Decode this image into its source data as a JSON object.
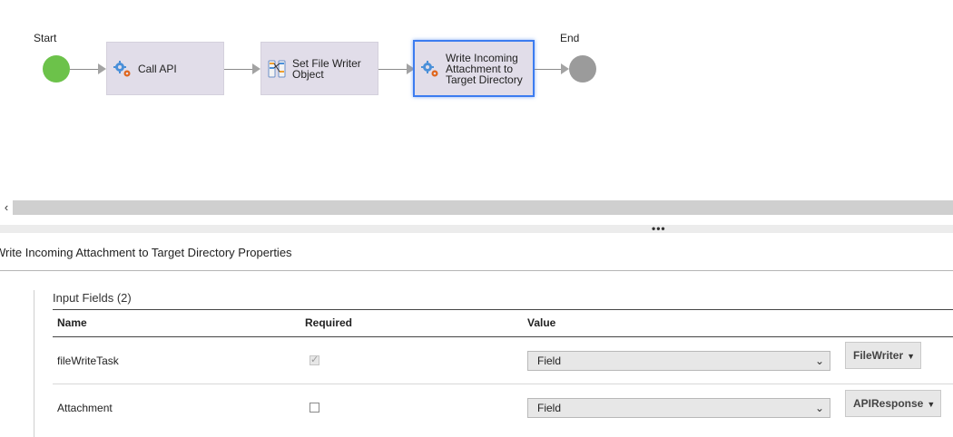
{
  "flow": {
    "start_label": "Start",
    "end_label": "End",
    "steps": [
      {
        "label": "Call API",
        "icon": "gears-icon"
      },
      {
        "label": "Set File Writer\nObject",
        "icon": "assignment-icon"
      },
      {
        "label": "Write Incoming\nAttachment to\nTarget Directory",
        "icon": "gears-icon"
      }
    ]
  },
  "splitter": {
    "dots": "•••"
  },
  "properties": {
    "title": "Write Incoming Attachment to Target Directory Properties",
    "section_title": "Input Fields (2)",
    "columns": {
      "name": "Name",
      "required": "Required",
      "value": "Value"
    },
    "rows": [
      {
        "name": "fileWriteTask",
        "required": true,
        "value_type": "Field",
        "field": "FileWriter"
      },
      {
        "name": "Attachment",
        "required": false,
        "value_type": "Field",
        "field": "APIResponse"
      }
    ]
  },
  "colors": {
    "start": "#6cc24a",
    "end": "#9b9b9b",
    "node_bg": "#e1dde9",
    "selected_border": "#3c7cf0"
  }
}
